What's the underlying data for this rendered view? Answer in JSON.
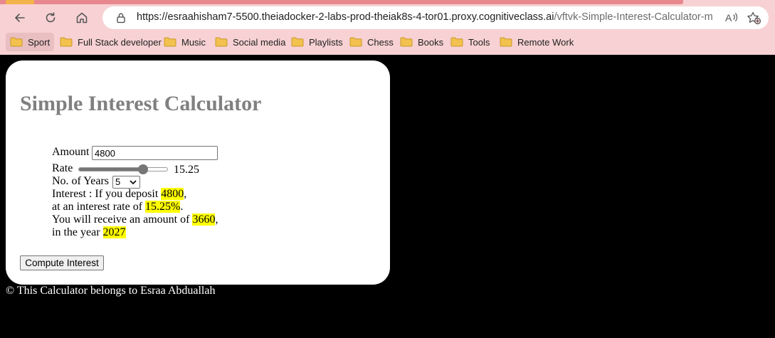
{
  "browser": {
    "url_host": "https://esraahisham7-5500.theiadocker-2-labs-prod-theiak8s-4-tor01.proxy.cognitiveclass.ai",
    "url_path": "/vftvk-Simple-Interest-Calculator-mas...",
    "bookmarks": [
      "Sport",
      "Full Stack developer",
      "Music",
      "Social media",
      "Playlists",
      "Chess",
      "Books",
      "Tools",
      "Remote Work"
    ]
  },
  "page": {
    "title": "Simple Interest Calculator",
    "amount_label": "Amount",
    "amount_value": "4800",
    "rate_label": "Rate",
    "rate_value": "15.25",
    "rate_slider_fraction": 0.75,
    "years_label": "No. of Years",
    "years_value": "5",
    "result": {
      "line1_prefix": "Interest : If you deposit ",
      "deposit": "4800",
      "line1_suffix": ",",
      "line2_prefix": "at an interest rate of ",
      "rate": "15.25%",
      "line2_suffix": ".",
      "line3_prefix": "You will receive an amount of ",
      "amount": "3660",
      "line3_suffix": ",",
      "line4_prefix": "in the year ",
      "year": "2027"
    },
    "compute_button": "Compute Interest",
    "footer": "© This Calculator belongs to Esraa Abduallah"
  },
  "colors": {
    "chrome_bg": "#f7d1d3",
    "highlight": "#ffff00",
    "title_color": "#808080",
    "folder_yellow": "#f2c14e"
  }
}
